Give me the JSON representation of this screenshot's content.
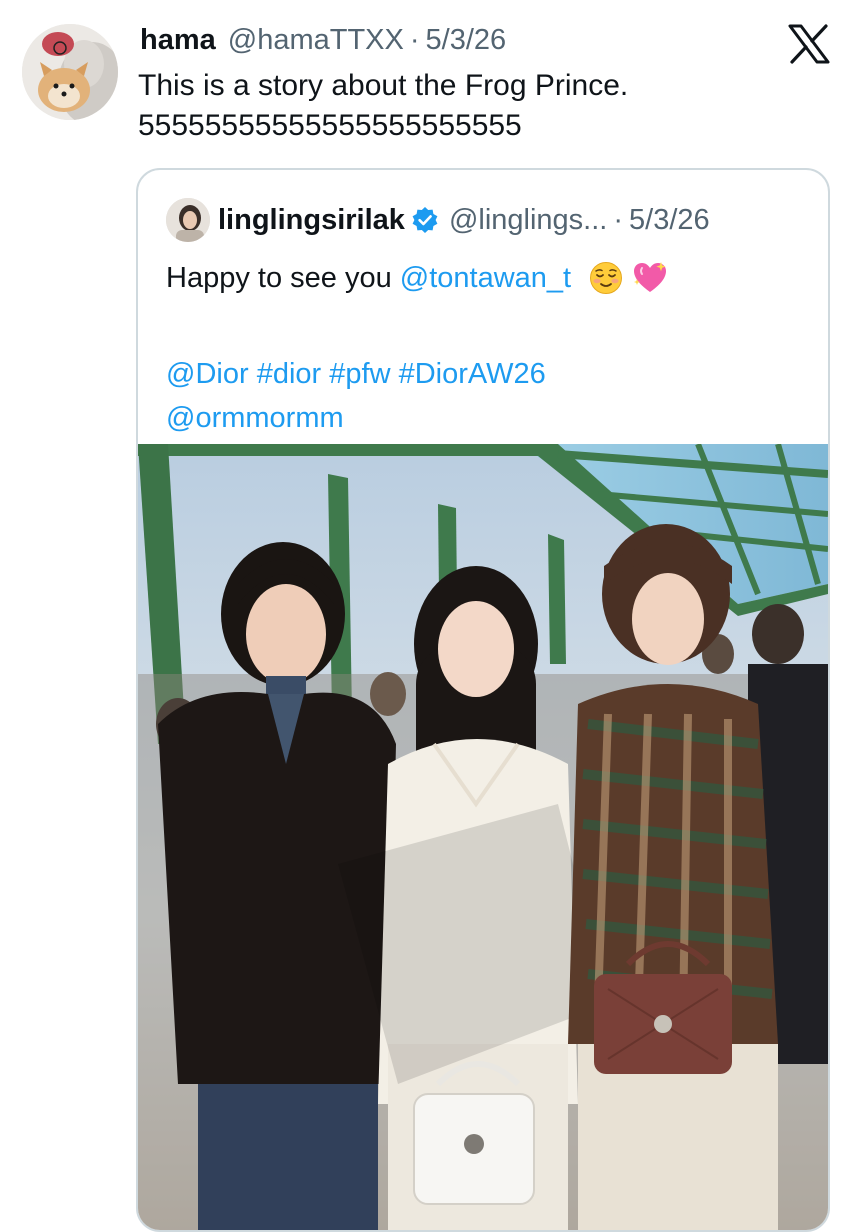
{
  "tweet": {
    "author_name": "hama",
    "author_handle": "@hamaTTXX",
    "separator": "·",
    "date": "5/3/26",
    "text_line1": "This is a story about the Frog Prince.",
    "text_line2": "55555555555555555555555"
  },
  "quote": {
    "author_name": "linglingsirilak",
    "author_handle": "@linglings...",
    "separator": "·",
    "date": "5/3/26",
    "text_prefix": "Happy to see you ",
    "mention_main": "@tontawan_t",
    "emojis": [
      "relieved-face-emoji",
      "sparkling-heart-emoji"
    ],
    "tags_line": [
      {
        "text": "@Dior",
        "kind": "mention"
      },
      {
        "text": "#dior",
        "kind": "hashtag"
      },
      {
        "text": "#pfw",
        "kind": "hashtag"
      },
      {
        "text": "#DiorAW26",
        "kind": "hashtag"
      }
    ],
    "mention_last": "@ormmormm",
    "verified": true
  },
  "colors": {
    "text": "#0f1419",
    "muted": "#536471",
    "link": "#1d9bf0",
    "border": "#cfd9de",
    "verified": "#1d9bf0"
  },
  "icons": {
    "platform_logo": "x-logo-icon",
    "verified_badge": "verified-badge-icon"
  }
}
